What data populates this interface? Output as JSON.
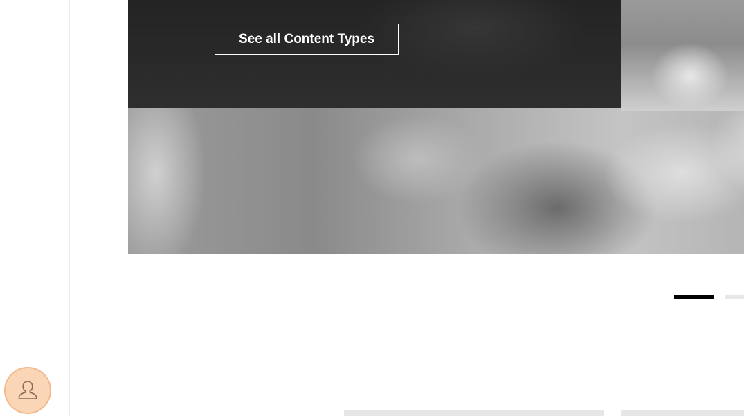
{
  "hero": {
    "cta_label": "See all Content Types"
  },
  "carousel": {
    "active_index": 0,
    "total": 2
  },
  "user": {
    "avatar_icon": "user-silhouette-icon"
  },
  "colors": {
    "avatar_bg": "#fbd6b6",
    "avatar_border": "#f3b98c",
    "indicator_active": "#000000",
    "indicator_inactive": "#e8e8e8"
  }
}
